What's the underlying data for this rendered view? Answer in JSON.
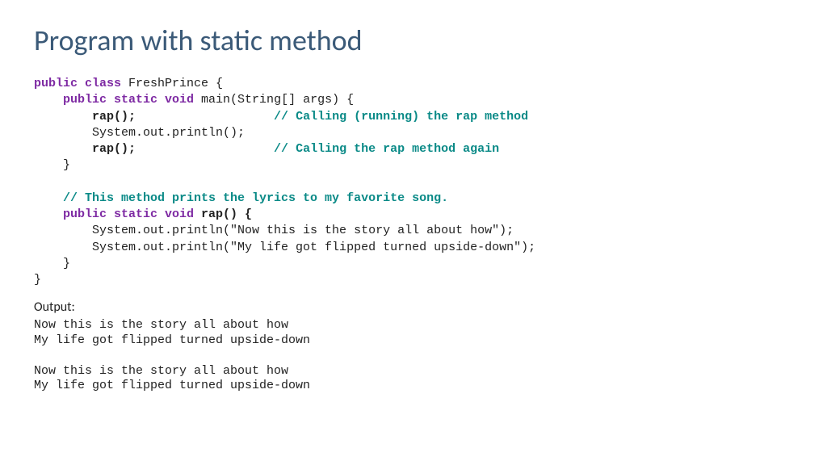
{
  "title": "Program with static method",
  "code": {
    "l1a": "public class",
    "l1b": " FreshPrince {",
    "l2a": "    public static void",
    "l2b": " main(String[] args) {",
    "l3a": "        rap();",
    "l3b": "                   // Calling (running) the rap method",
    "l4": "        System.out.println();",
    "l5a": "        rap();",
    "l5b": "                   // Calling the rap method again",
    "l6": "    }",
    "l7": "    // This method prints the lyrics to my favorite song.",
    "l8a": "    public static void",
    "l8b": " rap() {",
    "l9": "        System.out.println(\"Now this is the story all about how\");",
    "l10": "        System.out.println(\"My life got flipped turned upside-down\");",
    "l11": "    }",
    "l12": "}"
  },
  "output_label": "Output:",
  "output": "Now this is the story all about how\nMy life got flipped turned upside-down\n\nNow this is the story all about how\nMy life got flipped turned upside-down"
}
